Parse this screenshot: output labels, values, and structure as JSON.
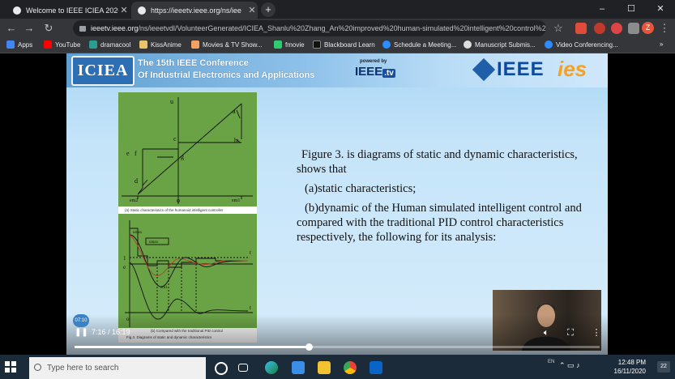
{
  "tabs": [
    {
      "title": "Welcome to IEEE ICIEA 2020",
      "active": false
    },
    {
      "title": "https://ieeetv.ieee.org/ns/iee",
      "active": true
    }
  ],
  "address": {
    "host": "ieeetv.ieee.org",
    "path": "/ns/ieeetvdl/VolunteerGenerated/ICIEA_Shanlu%20Zhang_An%20improved%20human-simulated%20intelligent%20control%20al..."
  },
  "profile_initial": "Z",
  "bookmarks": [
    {
      "label": "Apps",
      "color": "#4285f4"
    },
    {
      "label": "YouTube",
      "color": "#ff0000"
    },
    {
      "label": "dramacool",
      "color": "#2a9d8f"
    },
    {
      "label": "KissAnime",
      "color": "#e9c46a"
    },
    {
      "label": "Movies & TV Show...",
      "color": "#f4a261"
    },
    {
      "label": "fmovie",
      "color": "#2ecc71"
    },
    {
      "label": "Blackboard Learn",
      "color": "#111111"
    },
    {
      "label": "Schedule a Meeting...",
      "color": "#2d8cff"
    },
    {
      "label": "Manuscript Submis...",
      "color": "#dddddd"
    },
    {
      "label": "Video Conferencing...",
      "color": "#2d8cff"
    }
  ],
  "slide": {
    "conference_line1": "The 15th IEEE Conference",
    "conference_line2": "Of Industrial Electronics and Applications",
    "logo_iciea": "ICIEA",
    "powered_by": "powered by",
    "ieee_tv": "IEEE",
    "ieee_tv_suffix": ".tv",
    "ieee": "IEEE",
    "ies": "ies",
    "fig_top_caption": "(a) Static characteristics of the humanoid intelligent controller",
    "fig_bot_caption_1": "(b) Compared with the traditional PID control",
    "fig_bot_caption_2": "Fig.3. Diagrams of static and dynamic characteristics",
    "paragraph_1": "Figure 3. is diagrams of static and dynamic characteristics, shows that",
    "paragraph_2": "(a)static characteristics;",
    "paragraph_3": "(b)dynamic of the Human simulated intelligent control and compared with the traditional PID control characteristics respectively, the following for its analysis:",
    "fig_labels": {
      "u": "u",
      "a": "a",
      "b": "b",
      "c": "c",
      "d": "d",
      "e": "e",
      "f": "f",
      "g": "g",
      "o": "o",
      "em2": "em2",
      "em1": "em1",
      "umax": "umax",
      "umax2": "umax",
      "e1": "1",
      "t": "t",
      "e_axis": "e",
      "em1b": "em1"
    }
  },
  "player": {
    "bubble_time": "07:10",
    "current_time": "7:16",
    "duration": "16:19",
    "progress": 0.4463
  },
  "taskbar": {
    "search_placeholder": "Type here to search",
    "time": "12:48 PM",
    "date": "16/11/2020",
    "notifications": "22",
    "lang": "EN"
  }
}
